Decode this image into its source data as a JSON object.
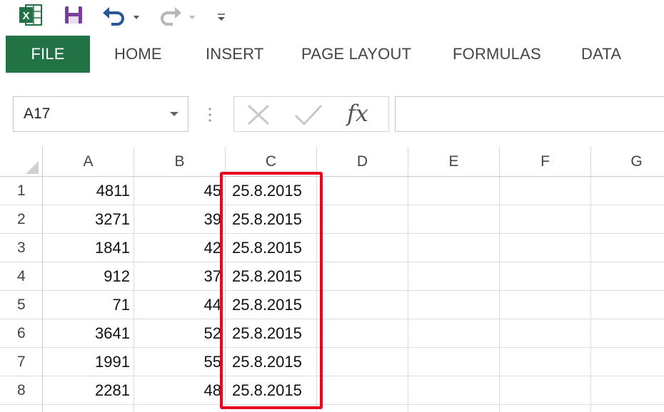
{
  "ribbon": {
    "tabs": [
      {
        "label": "FILE"
      },
      {
        "label": "HOME"
      },
      {
        "label": "INSERT"
      },
      {
        "label": "PAGE LAYOUT"
      },
      {
        "label": "FORMULAS"
      },
      {
        "label": "DATA"
      }
    ]
  },
  "formula_bar": {
    "name_box": "A17",
    "formula": ""
  },
  "sheet": {
    "columns": [
      "A",
      "B",
      "C",
      "D",
      "E",
      "F",
      "G"
    ],
    "rows": [
      {
        "row": "1",
        "A": "4811",
        "B": "45",
        "C": "25.8.2015"
      },
      {
        "row": "2",
        "A": "3271",
        "B": "39",
        "C": "25.8.2015"
      },
      {
        "row": "3",
        "A": "1841",
        "B": "42",
        "C": "25.8.2015"
      },
      {
        "row": "4",
        "A": "912",
        "B": "37",
        "C": "25.8.2015"
      },
      {
        "row": "5",
        "A": "71",
        "B": "44",
        "C": "25.8.2015"
      },
      {
        "row": "6",
        "A": "3641",
        "B": "52",
        "C": "25.8.2015"
      },
      {
        "row": "7",
        "A": "1991",
        "B": "55",
        "C": "25.8.2015"
      },
      {
        "row": "8",
        "A": "2281",
        "B": "48",
        "C": "25.8.2015"
      }
    ]
  },
  "colors": {
    "file_tab": "#217346",
    "highlight": "#e8001c"
  }
}
